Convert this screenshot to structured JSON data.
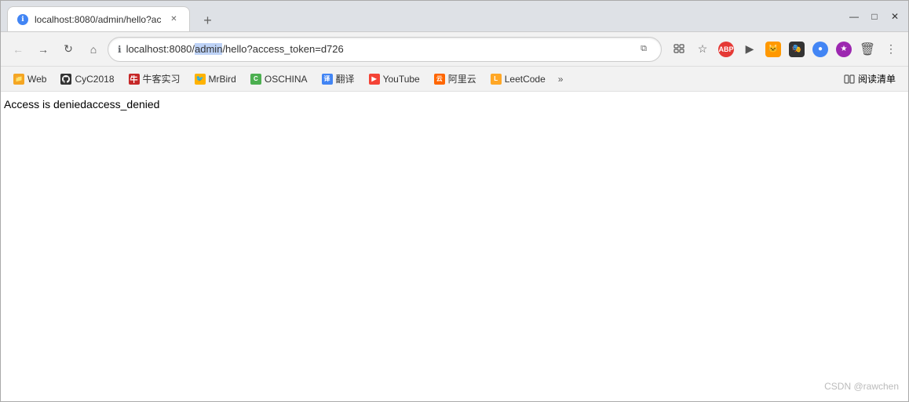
{
  "window": {
    "title": "localhost:8080/admin/hello?ac",
    "tab_label": "localhost:8080/admin/hello?ac"
  },
  "address_bar": {
    "url": "localhost:8080/admin/hello?access_token=d726",
    "url_pre": "localhost:8080/",
    "url_highlight": "admin",
    "url_post": "/hello?access_token=d726"
  },
  "bookmarks": [
    {
      "id": "web",
      "icon": "📁",
      "label": "Web",
      "color": "#f5a623"
    },
    {
      "id": "github",
      "icon": "🐙",
      "label": "CyC2018",
      "color": "#333"
    },
    {
      "id": "niumo",
      "icon": "📝",
      "label": "牛客实习",
      "color": "#c62828"
    },
    {
      "id": "mrbird",
      "icon": "🐦",
      "label": "MrBird",
      "color": "#f9d74e"
    },
    {
      "id": "oschina",
      "icon": "©",
      "label": "OSCHINA",
      "color": "#4caf50"
    },
    {
      "id": "translate",
      "icon": "译",
      "label": "翻译",
      "color": "#4285f4"
    },
    {
      "id": "youtube",
      "icon": "▶",
      "label": "YouTube",
      "color": "#f44336"
    },
    {
      "id": "ali",
      "icon": "云",
      "label": "阿里云",
      "color": "#ff6600"
    },
    {
      "id": "leetcode",
      "icon": "L",
      "label": "LeetCode",
      "color": "#ffa726"
    }
  ],
  "page": {
    "content": "Access is deniedaccess_denied"
  },
  "watermark": "CSDN @rawchen",
  "nav": {
    "back": "←",
    "forward": "→",
    "reload": "↻",
    "home": "⌂"
  },
  "window_controls": {
    "minimize": "—",
    "maximize": "□",
    "close": "✕"
  },
  "reader_mode": "阅读清单"
}
